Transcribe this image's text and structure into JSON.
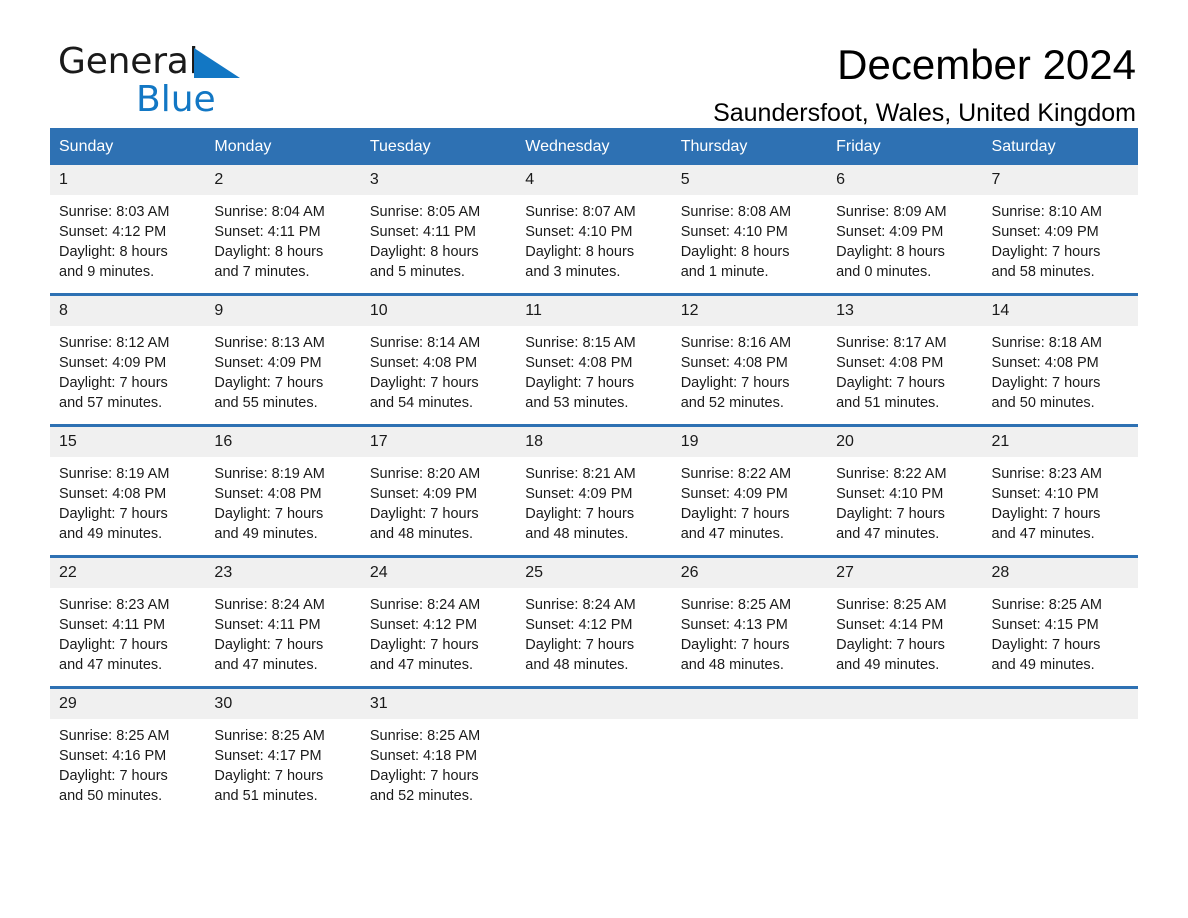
{
  "brand": {
    "logo_line1": "General",
    "logo_line2": "Blue",
    "triangle_color": "#1277c4"
  },
  "header": {
    "title": "December 2024",
    "subtitle": "Saundersfoot, Wales, United Kingdom"
  },
  "theme": {
    "accent": "#2e71b3",
    "daynum_background": "#f0f0f0",
    "text": "#1a1a1a"
  },
  "calendar": {
    "weekday_headers": [
      "Sunday",
      "Monday",
      "Tuesday",
      "Wednesday",
      "Thursday",
      "Friday",
      "Saturday"
    ],
    "weeks": [
      [
        {
          "day": "1",
          "sunrise": "Sunrise: 8:03 AM",
          "sunset": "Sunset: 4:12 PM",
          "daylight_line1": "Daylight: 8 hours",
          "daylight_line2": "and 9 minutes."
        },
        {
          "day": "2",
          "sunrise": "Sunrise: 8:04 AM",
          "sunset": "Sunset: 4:11 PM",
          "daylight_line1": "Daylight: 8 hours",
          "daylight_line2": "and 7 minutes."
        },
        {
          "day": "3",
          "sunrise": "Sunrise: 8:05 AM",
          "sunset": "Sunset: 4:11 PM",
          "daylight_line1": "Daylight: 8 hours",
          "daylight_line2": "and 5 minutes."
        },
        {
          "day": "4",
          "sunrise": "Sunrise: 8:07 AM",
          "sunset": "Sunset: 4:10 PM",
          "daylight_line1": "Daylight: 8 hours",
          "daylight_line2": "and 3 minutes."
        },
        {
          "day": "5",
          "sunrise": "Sunrise: 8:08 AM",
          "sunset": "Sunset: 4:10 PM",
          "daylight_line1": "Daylight: 8 hours",
          "daylight_line2": "and 1 minute."
        },
        {
          "day": "6",
          "sunrise": "Sunrise: 8:09 AM",
          "sunset": "Sunset: 4:09 PM",
          "daylight_line1": "Daylight: 8 hours",
          "daylight_line2": "and 0 minutes."
        },
        {
          "day": "7",
          "sunrise": "Sunrise: 8:10 AM",
          "sunset": "Sunset: 4:09 PM",
          "daylight_line1": "Daylight: 7 hours",
          "daylight_line2": "and 58 minutes."
        }
      ],
      [
        {
          "day": "8",
          "sunrise": "Sunrise: 8:12 AM",
          "sunset": "Sunset: 4:09 PM",
          "daylight_line1": "Daylight: 7 hours",
          "daylight_line2": "and 57 minutes."
        },
        {
          "day": "9",
          "sunrise": "Sunrise: 8:13 AM",
          "sunset": "Sunset: 4:09 PM",
          "daylight_line1": "Daylight: 7 hours",
          "daylight_line2": "and 55 minutes."
        },
        {
          "day": "10",
          "sunrise": "Sunrise: 8:14 AM",
          "sunset": "Sunset: 4:08 PM",
          "daylight_line1": "Daylight: 7 hours",
          "daylight_line2": "and 54 minutes."
        },
        {
          "day": "11",
          "sunrise": "Sunrise: 8:15 AM",
          "sunset": "Sunset: 4:08 PM",
          "daylight_line1": "Daylight: 7 hours",
          "daylight_line2": "and 53 minutes."
        },
        {
          "day": "12",
          "sunrise": "Sunrise: 8:16 AM",
          "sunset": "Sunset: 4:08 PM",
          "daylight_line1": "Daylight: 7 hours",
          "daylight_line2": "and 52 minutes."
        },
        {
          "day": "13",
          "sunrise": "Sunrise: 8:17 AM",
          "sunset": "Sunset: 4:08 PM",
          "daylight_line1": "Daylight: 7 hours",
          "daylight_line2": "and 51 minutes."
        },
        {
          "day": "14",
          "sunrise": "Sunrise: 8:18 AM",
          "sunset": "Sunset: 4:08 PM",
          "daylight_line1": "Daylight: 7 hours",
          "daylight_line2": "and 50 minutes."
        }
      ],
      [
        {
          "day": "15",
          "sunrise": "Sunrise: 8:19 AM",
          "sunset": "Sunset: 4:08 PM",
          "daylight_line1": "Daylight: 7 hours",
          "daylight_line2": "and 49 minutes."
        },
        {
          "day": "16",
          "sunrise": "Sunrise: 8:19 AM",
          "sunset": "Sunset: 4:08 PM",
          "daylight_line1": "Daylight: 7 hours",
          "daylight_line2": "and 49 minutes."
        },
        {
          "day": "17",
          "sunrise": "Sunrise: 8:20 AM",
          "sunset": "Sunset: 4:09 PM",
          "daylight_line1": "Daylight: 7 hours",
          "daylight_line2": "and 48 minutes."
        },
        {
          "day": "18",
          "sunrise": "Sunrise: 8:21 AM",
          "sunset": "Sunset: 4:09 PM",
          "daylight_line1": "Daylight: 7 hours",
          "daylight_line2": "and 48 minutes."
        },
        {
          "day": "19",
          "sunrise": "Sunrise: 8:22 AM",
          "sunset": "Sunset: 4:09 PM",
          "daylight_line1": "Daylight: 7 hours",
          "daylight_line2": "and 47 minutes."
        },
        {
          "day": "20",
          "sunrise": "Sunrise: 8:22 AM",
          "sunset": "Sunset: 4:10 PM",
          "daylight_line1": "Daylight: 7 hours",
          "daylight_line2": "and 47 minutes."
        },
        {
          "day": "21",
          "sunrise": "Sunrise: 8:23 AM",
          "sunset": "Sunset: 4:10 PM",
          "daylight_line1": "Daylight: 7 hours",
          "daylight_line2": "and 47 minutes."
        }
      ],
      [
        {
          "day": "22",
          "sunrise": "Sunrise: 8:23 AM",
          "sunset": "Sunset: 4:11 PM",
          "daylight_line1": "Daylight: 7 hours",
          "daylight_line2": "and 47 minutes."
        },
        {
          "day": "23",
          "sunrise": "Sunrise: 8:24 AM",
          "sunset": "Sunset: 4:11 PM",
          "daylight_line1": "Daylight: 7 hours",
          "daylight_line2": "and 47 minutes."
        },
        {
          "day": "24",
          "sunrise": "Sunrise: 8:24 AM",
          "sunset": "Sunset: 4:12 PM",
          "daylight_line1": "Daylight: 7 hours",
          "daylight_line2": "and 47 minutes."
        },
        {
          "day": "25",
          "sunrise": "Sunrise: 8:24 AM",
          "sunset": "Sunset: 4:12 PM",
          "daylight_line1": "Daylight: 7 hours",
          "daylight_line2": "and 48 minutes."
        },
        {
          "day": "26",
          "sunrise": "Sunrise: 8:25 AM",
          "sunset": "Sunset: 4:13 PM",
          "daylight_line1": "Daylight: 7 hours",
          "daylight_line2": "and 48 minutes."
        },
        {
          "day": "27",
          "sunrise": "Sunrise: 8:25 AM",
          "sunset": "Sunset: 4:14 PM",
          "daylight_line1": "Daylight: 7 hours",
          "daylight_line2": "and 49 minutes."
        },
        {
          "day": "28",
          "sunrise": "Sunrise: 8:25 AM",
          "sunset": "Sunset: 4:15 PM",
          "daylight_line1": "Daylight: 7 hours",
          "daylight_line2": "and 49 minutes."
        }
      ],
      [
        {
          "day": "29",
          "sunrise": "Sunrise: 8:25 AM",
          "sunset": "Sunset: 4:16 PM",
          "daylight_line1": "Daylight: 7 hours",
          "daylight_line2": "and 50 minutes."
        },
        {
          "day": "30",
          "sunrise": "Sunrise: 8:25 AM",
          "sunset": "Sunset: 4:17 PM",
          "daylight_line1": "Daylight: 7 hours",
          "daylight_line2": "and 51 minutes."
        },
        {
          "day": "31",
          "sunrise": "Sunrise: 8:25 AM",
          "sunset": "Sunset: 4:18 PM",
          "daylight_line1": "Daylight: 7 hours",
          "daylight_line2": "and 52 minutes."
        },
        {
          "day": "",
          "sunrise": "",
          "sunset": "",
          "daylight_line1": "",
          "daylight_line2": ""
        },
        {
          "day": "",
          "sunrise": "",
          "sunset": "",
          "daylight_line1": "",
          "daylight_line2": ""
        },
        {
          "day": "",
          "sunrise": "",
          "sunset": "",
          "daylight_line1": "",
          "daylight_line2": ""
        },
        {
          "day": "",
          "sunrise": "",
          "sunset": "",
          "daylight_line1": "",
          "daylight_line2": ""
        }
      ]
    ]
  }
}
